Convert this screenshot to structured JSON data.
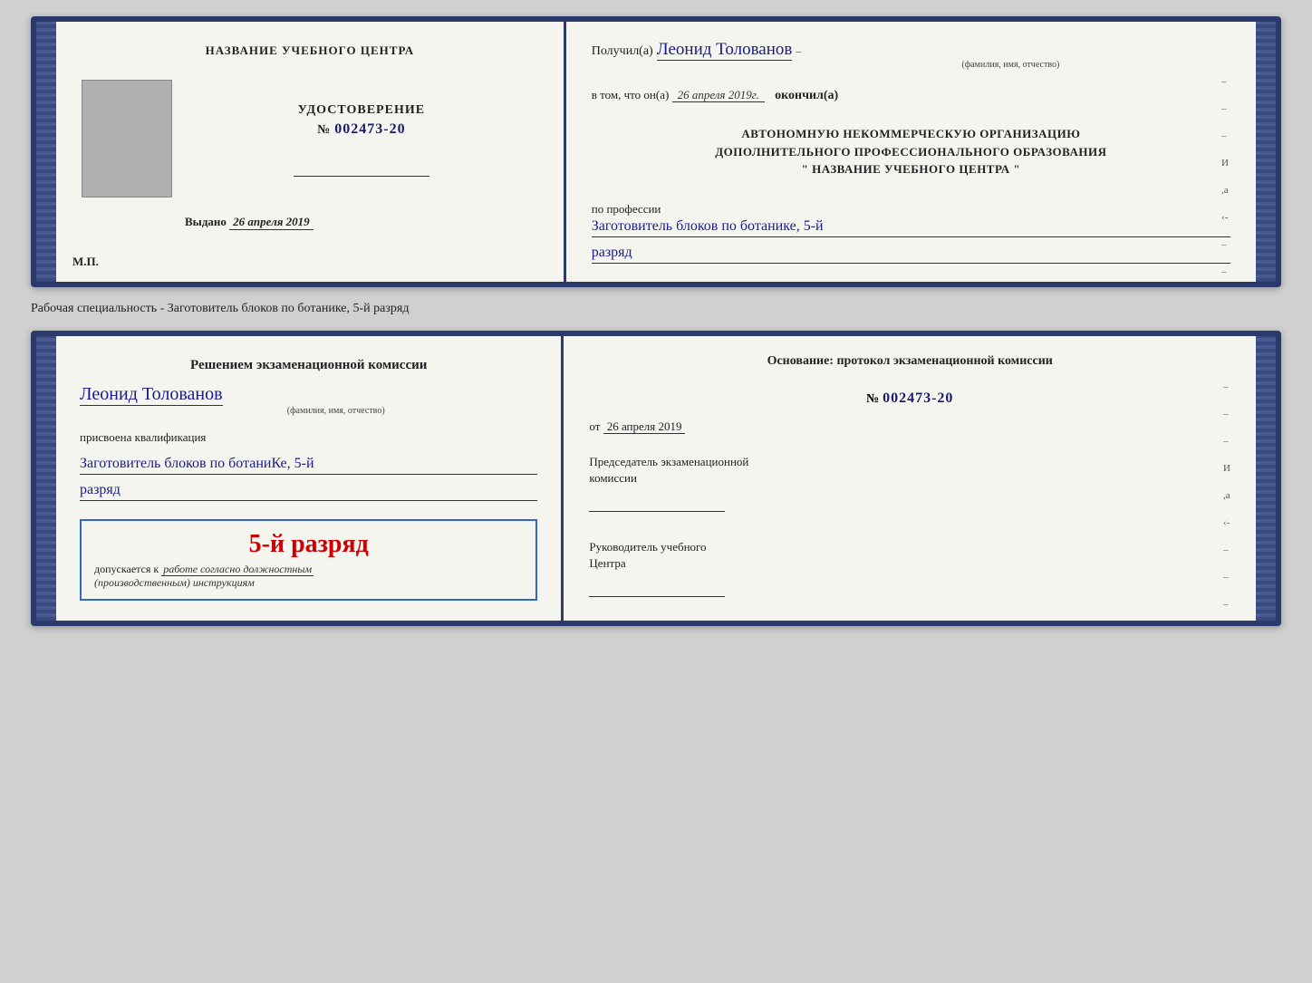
{
  "upper": {
    "left": {
      "header": "НАЗВАНИЕ УЧЕБНОГО ЦЕНТРА",
      "document_type": "УДОСТОВЕРЕНИЕ",
      "number_prefix": "№",
      "number": "002473-20",
      "issued_label": "Выдано",
      "issued_date": "26 апреля 2019",
      "mp_label": "М.П."
    },
    "right": {
      "received_prefix": "Получил(а)",
      "recipient_name": "Леонид Толованов",
      "recipient_caption": "(фамилия, имя, отчество)",
      "date_prefix": "в том, что он(а)",
      "date_value": "26 апреля 2019г.",
      "date_suffix": "окончил(а)",
      "org_line1": "АВТОНОМНУЮ НЕКОММЕРЧЕСКУЮ ОРГАНИЗАЦИЮ",
      "org_line2": "ДОПОЛНИТЕЛЬНОГО ПРОФЕССИОНАЛЬНОГО ОБРАЗОВАНИЯ",
      "org_line3": "\"   НАЗВАНИЕ УЧЕБНОГО ЦЕНТРА   \"",
      "profession_label": "по профессии",
      "profession_value": "Заготовитель блоков по ботанике, 5-й",
      "rank_value": "разряд",
      "side_marks": [
        "–",
        "–",
        "–",
        "И",
        ",а",
        "‹-",
        "–",
        "–",
        "–",
        "–"
      ]
    }
  },
  "specialty_label": "Рабочая специальность - Заготовитель блоков по ботанике, 5-й разряд",
  "lower": {
    "left": {
      "commission_text": "Решением экзаменационной комиссии",
      "person_name": "Леонид Толованов",
      "person_caption": "(фамилия, имя, отчество)",
      "qualification_label": "присвоена квалификация",
      "qualification_value": "Заготовитель блоков по ботаниКе, 5-й",
      "rank_value": "разряд",
      "rank_display": "5-й разряд",
      "allowed_prefix": "допускается к",
      "allowed_text": "работе согласно должностным",
      "allowed_text2": "(производственным) инструкциям"
    },
    "right": {
      "basis_title": "Основание: протокол экзаменационной комиссии",
      "number_prefix": "№",
      "number": "002473-20",
      "date_prefix": "от",
      "date_value": "26 апреля 2019",
      "chairman_title": "Председатель экзаменационной",
      "chairman_title2": "комиссии",
      "director_title": "Руководитель учебного",
      "director_title2": "Центра",
      "side_marks": [
        "–",
        "–",
        "–",
        "И",
        ",а",
        "‹-",
        "–",
        "–",
        "–",
        "–"
      ]
    }
  }
}
